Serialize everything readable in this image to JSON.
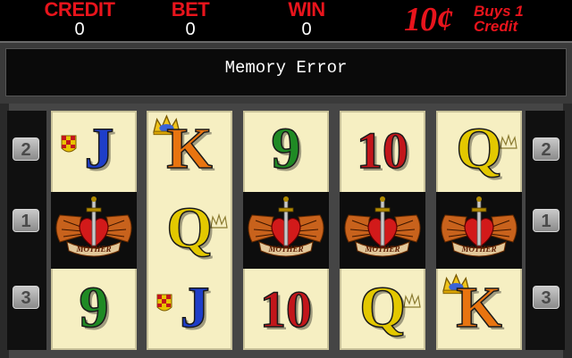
{
  "meters": {
    "credit": {
      "label": "CREDIT",
      "value": "0"
    },
    "bet": {
      "label": "BET",
      "value": "0"
    },
    "win": {
      "label": "WIN",
      "value": "0"
    }
  },
  "denomination": {
    "amount": "10¢",
    "text": "Buys 1 Credit"
  },
  "message": "Memory Error",
  "paylines": {
    "left": [
      "2",
      "1",
      "3"
    ],
    "right": [
      "2",
      "1",
      "3"
    ]
  },
  "reels": [
    [
      "J",
      "MOTHER",
      "9"
    ],
    [
      "K",
      "Q",
      "J"
    ],
    [
      "9",
      "MOTHER",
      "10"
    ],
    [
      "10",
      "MOTHER",
      "Q"
    ],
    [
      "Q",
      "MOTHER",
      "K"
    ]
  ],
  "colors": {
    "meter_label": "#e8141c",
    "reel_background": "#f6efc2",
    "symbol_9": "#1f8a24",
    "symbol_10": "#c2161b",
    "symbol_J": "#1e3ec9",
    "symbol_Q": "#e3c800",
    "symbol_K": "#e87410"
  }
}
